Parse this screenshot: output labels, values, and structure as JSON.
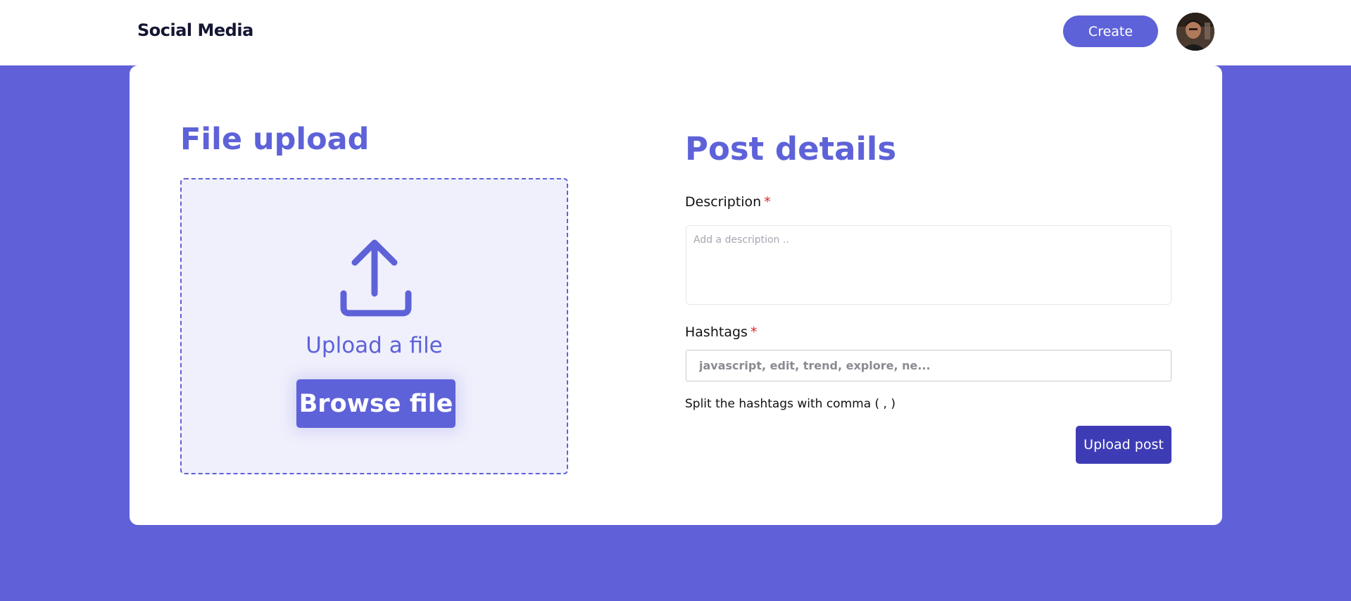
{
  "navbar": {
    "brand": "Social Media",
    "create_label": "Create",
    "avatar_alt": "User avatar"
  },
  "file_upload": {
    "title": "File upload",
    "upload_text": "Upload a file",
    "browse_label": "Browse file",
    "icon": "upload-icon"
  },
  "post_details": {
    "title": "Post details",
    "description_label": "Description",
    "description_required": "*",
    "description_placeholder": "Add a description ..",
    "hashtags_label": "Hashtags",
    "hashtags_required": "*",
    "hashtags_placeholder": "javascript, edit, trend, explore, ne...",
    "hint": "Split the hashtags with comma ( , )",
    "submit_label": "Upload post"
  },
  "colors": {
    "accent": "#5e62d8",
    "background": "#6061d8",
    "submit": "#3e3cb5",
    "required": "#e02424"
  }
}
